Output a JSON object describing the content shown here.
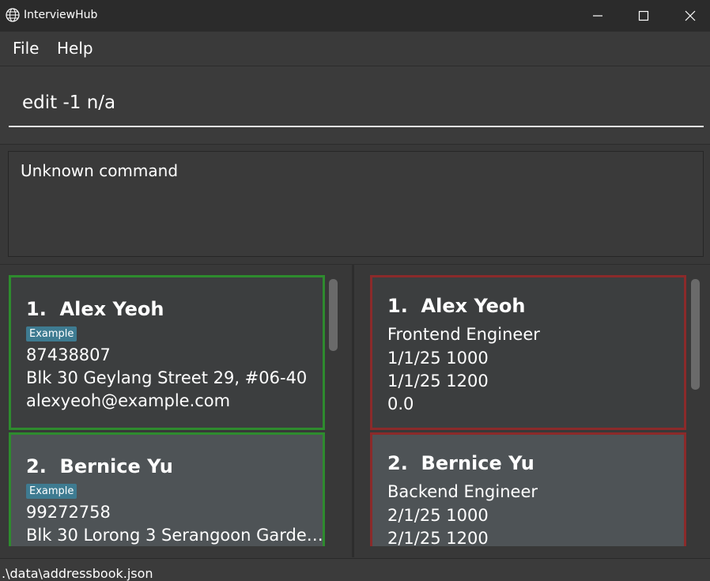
{
  "window": {
    "title": "InterviewHub",
    "icon": "globe-icon"
  },
  "menu": {
    "file": "File",
    "help": "Help"
  },
  "command": {
    "value": "edit -1 n/a"
  },
  "result": {
    "text": "Unknown command"
  },
  "persons": [
    {
      "index": "1.",
      "name": "Alex Yeoh",
      "tag": "Example",
      "phone": "87438807",
      "address": "Blk 30 Geylang Street 29, #06-40",
      "email": "alexyeoh@example.com"
    },
    {
      "index": "2.",
      "name": "Bernice Yu",
      "tag": "Example",
      "phone": "99272758",
      "address": "Blk 30 Lorong 3 Serangoon Garde…"
    }
  ],
  "applications": [
    {
      "index": "1.",
      "name": "Alex Yeoh",
      "role": "Frontend Engineer",
      "start": "1/1/25 1000",
      "end": "1/1/25 1200",
      "score": "0.0"
    },
    {
      "index": "2.",
      "name": "Bernice Yu",
      "role": "Backend Engineer",
      "start": "2/1/25 1000",
      "end": "2/1/25 1200"
    }
  ],
  "status": {
    "path": ".\\data\\addressbook.json"
  },
  "colors": {
    "person_border": "#2e8b2e",
    "application_border": "#8b2a2a",
    "tag_bg": "#3e7b91"
  }
}
